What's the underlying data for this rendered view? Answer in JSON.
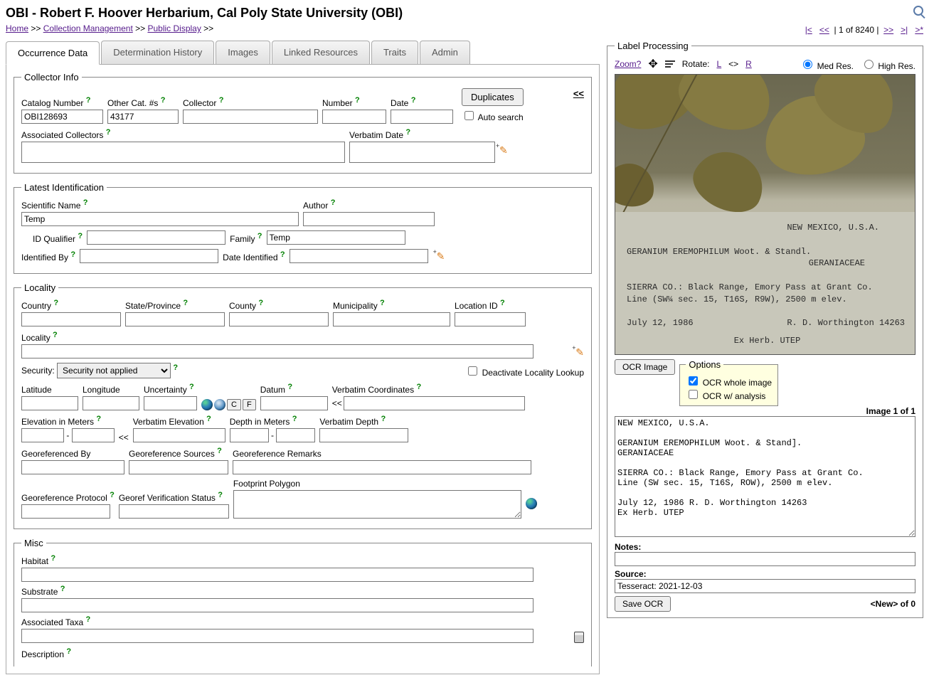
{
  "header": {
    "title": "OBI - Robert F. Hoover Herbarium, Cal Poly State University (OBI)",
    "breadcrumb": {
      "home": "Home",
      "cm": "Collection Management",
      "pd": "Public Display",
      "sep": " >> "
    },
    "nav": {
      "first": "|<",
      "prev": "<<",
      "pos": "| 1 of 8240 |",
      "next": ">>",
      "last": ">|",
      "new": ">*"
    }
  },
  "tabs": [
    "Occurrence Data",
    "Determination History",
    "Images",
    "Linked Resources",
    "Traits",
    "Admin"
  ],
  "collector": {
    "legend": "Collector Info",
    "catalog_label": "Catalog Number",
    "catalog_val": "OBI128693",
    "othercat_label": "Other Cat. #s",
    "othercat_val": "43177",
    "collector_label": "Collector",
    "number_label": "Number",
    "date_label": "Date",
    "dup_btn": "Duplicates",
    "autosearch_label": "Auto search",
    "assoc_label": "Associated Collectors",
    "verbdate_label": "Verbatim Date",
    "collapse": "<<"
  },
  "ident": {
    "legend": "Latest Identification",
    "sciname_label": "Scientific Name",
    "sciname_val": "Temp",
    "author_label": "Author",
    "idqual_label": "ID Qualifier",
    "family_label": "Family",
    "family_val": "Temp",
    "idby_label": "Identified By",
    "dateid_label": "Date Identified"
  },
  "locality": {
    "legend": "Locality",
    "country_label": "Country",
    "state_label": "State/Province",
    "county_label": "County",
    "muni_label": "Municipality",
    "locid_label": "Location ID",
    "locality_label": "Locality",
    "security_label": "Security:",
    "security_opt": "Security not applied",
    "deact_label": "Deactivate Locality Lookup",
    "lat_label": "Latitude",
    "lon_label": "Longitude",
    "uncert_label": "Uncertainty",
    "datum_label": "Datum",
    "verbcoord_label": "Verbatim Coordinates",
    "c_btn": "C",
    "f_btn": "F",
    "arrow": "<<",
    "elev_label": "Elevation in Meters",
    "dash": "-",
    "verbelev_label": "Verbatim Elevation",
    "depth_label": "Depth in Meters",
    "verbdepth_label": "Verbatim Depth",
    "georefby_label": "Georeferenced By",
    "georefsrc_label": "Georeference Sources",
    "georefrem_label": "Georeference Remarks",
    "georefprot_label": "Georeference Protocol",
    "georefver_label": "Georef Verification Status",
    "footprint_label": "Footprint Polygon"
  },
  "misc": {
    "legend": "Misc",
    "habitat_label": "Habitat",
    "substrate_label": "Substrate",
    "assoctaxa_label": "Associated Taxa",
    "desc_label": "Description"
  },
  "label_proc": {
    "legend": "Label Processing",
    "zoom": "Zoom?",
    "rotate": "Rotate:",
    "rot_l": " L ",
    "rot_swap": " <> ",
    "rot_r": " R ",
    "medres": "Med Res.",
    "highres": "High Res.",
    "ocr_btn": "OCR Image",
    "options_legend": "Options",
    "ocr_whole": "OCR whole image",
    "ocr_anal": "OCR w/ analysis",
    "img_counter": "Image 1 of 1",
    "ocr_text": "NEW MEXICO, U.S.A.\n\nGERANIUM EREMOPHILUM Woot. & Stand].\nGERANIACEAE\n\nSIERRA CO.: Black Range, Emory Pass at Grant Co.\nLine (SW sec. 15, T16S, ROW), 2500 m elev.\n\nJuly 12, 1986 R. D. Worthington 14263\nEx Herb. UTEP",
    "notes_label": "Notes:",
    "source_label": "Source:",
    "source_val": "Tesseract: 2021-12-03",
    "save_btn": "Save OCR",
    "bottom_counter": "<New> of 0"
  },
  "specimen_label": {
    "l1": "NEW MEXICO, U.S.A.",
    "l2": "GERANIUM EREMOPHILUM Woot. & Standl.",
    "l3": "GERANIACEAE",
    "l4": "SIERRA CO.: Black Range, Emory Pass at Grant Co.",
    "l5": "Line (SW¼ sec. 15, T16S, R9W), 2500 m elev.",
    "l6": "July 12, 1986",
    "l7": "R. D. Worthington  14263",
    "l8": "Ex Herb. UTEP"
  }
}
